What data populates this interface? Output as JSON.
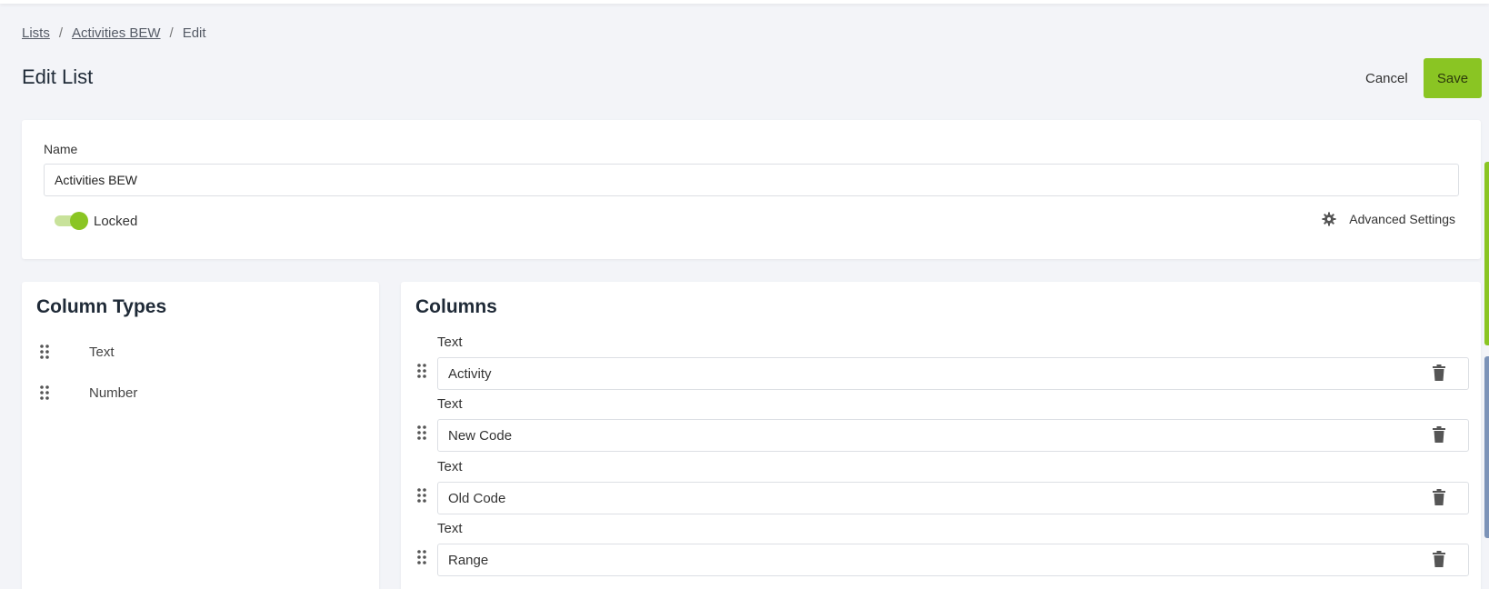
{
  "breadcrumb": {
    "items": [
      "Lists",
      "Activities BEW",
      "Edit"
    ],
    "separator": "/"
  },
  "page": {
    "title": "Edit List"
  },
  "actions": {
    "cancel_label": "Cancel",
    "save_label": "Save"
  },
  "name_section": {
    "label": "Name",
    "value": "Activities BEW",
    "locked_label": "Locked",
    "locked_on": true,
    "advanced_settings_label": "Advanced Settings"
  },
  "column_types": {
    "title": "Column Types",
    "items": [
      {
        "label": "Text",
        "icon": "drag-handle-icon"
      },
      {
        "label": "Number",
        "icon": "drag-handle-icon"
      }
    ]
  },
  "columns": {
    "title": "Columns",
    "items": [
      {
        "type": "Text",
        "value": "Activity"
      },
      {
        "type": "Text",
        "value": "New Code"
      },
      {
        "type": "Text",
        "value": "Old Code"
      },
      {
        "type": "Text",
        "value": "Range"
      }
    ]
  },
  "colors": {
    "accent_green": "#8ac523",
    "toggle_track": "#c8e29a",
    "background": "#f3f4f8",
    "card": "#ffffff"
  }
}
